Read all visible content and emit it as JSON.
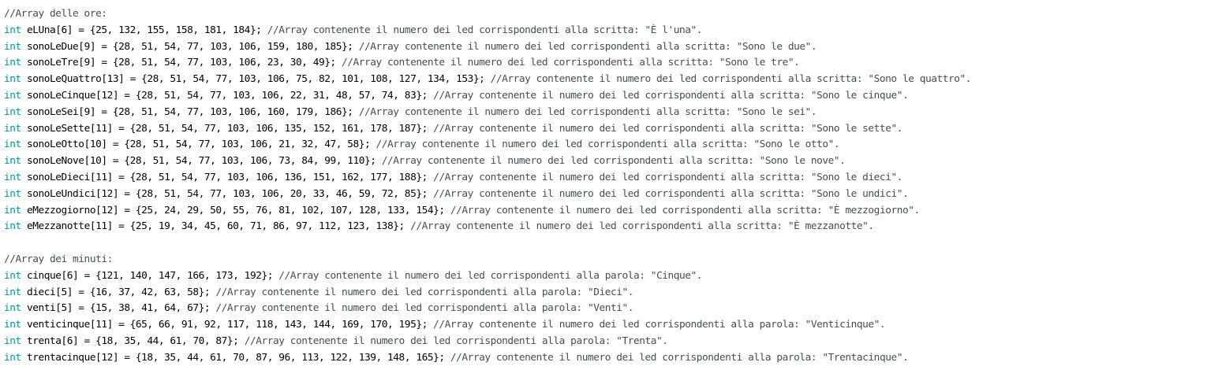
{
  "editor": {
    "lines": [
      {
        "type": "comment",
        "text": "//Array delle ore:"
      },
      {
        "type": "code",
        "kw": "int",
        "code": " eLUna[6] = {25, 132, 155, 158, 181, 184}; ",
        "comment": "//Array contenente il numero dei led corrispondenti alla scritta: \"È l'una\"."
      },
      {
        "type": "code",
        "kw": "int",
        "code": " sonoLeDue[9] = {28, 51, 54, 77, 103, 106, 159, 180, 185}; ",
        "comment": "//Array contenente il numero dei led corrispondenti alla scritta: \"Sono le due\"."
      },
      {
        "type": "code",
        "kw": "int",
        "code": " sonoLeTre[9] = {28, 51, 54, 77, 103, 106, 23, 30, 49}; ",
        "comment": "//Array contenente il numero dei led corrispondenti alla scritta: \"Sono le tre\"."
      },
      {
        "type": "code",
        "kw": "int",
        "code": " sonoLeQuattro[13] = {28, 51, 54, 77, 103, 106, 75, 82, 101, 108, 127, 134, 153}; ",
        "comment": "//Array contenente il numero dei led corrispondenti alla scritta: \"Sono le quattro\"."
      },
      {
        "type": "code",
        "kw": "int",
        "code": " sonoLeCinque[12] = {28, 51, 54, 77, 103, 106, 22, 31, 48, 57, 74, 83}; ",
        "comment": "//Array contenente il numero dei led corrispondenti alla scritta: \"Sono le cinque\"."
      },
      {
        "type": "code",
        "kw": "int",
        "code": " sonoLeSei[9] = {28, 51, 54, 77, 103, 106, 160, 179, 186}; ",
        "comment": "//Array contenente il numero dei led corrispondenti alla scritta: \"Sono le sei\"."
      },
      {
        "type": "code",
        "kw": "int",
        "code": " sonoLeSette[11] = {28, 51, 54, 77, 103, 106, 135, 152, 161, 178, 187}; ",
        "comment": "//Array contenente il numero dei led corrispondenti alla scritta: \"Sono le sette\"."
      },
      {
        "type": "code",
        "kw": "int",
        "code": " sonoLeOtto[10] = {28, 51, 54, 77, 103, 106, 21, 32, 47, 58}; ",
        "comment": "//Array contenente il numero dei led corrispondenti alla scritta: \"Sono le otto\"."
      },
      {
        "type": "code",
        "kw": "int",
        "code": " sonoLeNove[10] = {28, 51, 54, 77, 103, 106, 73, 84, 99, 110}; ",
        "comment": "//Array contenente il numero dei led corrispondenti alla scritta: \"Sono le nove\"."
      },
      {
        "type": "code",
        "kw": "int",
        "code": " sonoLeDieci[11] = {28, 51, 54, 77, 103, 106, 136, 151, 162, 177, 188}; ",
        "comment": "//Array contenente il numero dei led corrispondenti alla scritta: \"Sono le dieci\"."
      },
      {
        "type": "code",
        "kw": "int",
        "code": " sonoLeUndici[12] = {28, 51, 54, 77, 103, 106, 20, 33, 46, 59, 72, 85}; ",
        "comment": "//Array contenente il numero dei led corrispondenti alla scritta: \"Sono le undici\"."
      },
      {
        "type": "code",
        "kw": "int",
        "code": " eMezzogiorno[12] = {25, 24, 29, 50, 55, 76, 81, 102, 107, 128, 133, 154}; ",
        "comment": "//Array contenente il numero dei led corrispondenti alla scritta: \"È mezzogiorno\"."
      },
      {
        "type": "code",
        "kw": "int",
        "code": " eMezzanotte[11] = {25, 19, 34, 45, 60, 71, 86, 97, 112, 123, 138}; ",
        "comment": "//Array contenente il numero dei led corrispondenti alla scritta: \"È mezzanotte\"."
      },
      {
        "type": "blank",
        "text": ""
      },
      {
        "type": "comment",
        "text": "//Array dei minuti:"
      },
      {
        "type": "code",
        "kw": "int",
        "code": " cinque[6] = {121, 140, 147, 166, 173, 192}; ",
        "comment": "//Array contenente il numero dei led corrispondenti alla parola: \"Cinque\"."
      },
      {
        "type": "code",
        "kw": "int",
        "code": " dieci[5] = {16, 37, 42, 63, 58}; ",
        "comment": "//Array contenente il numero dei led corrispondenti alla parola: \"Dieci\"."
      },
      {
        "type": "code",
        "kw": "int",
        "code": " venti[5] = {15, 38, 41, 64, 67}; ",
        "comment": "//Array contenente il numero dei led corrispondenti alla parola: \"Venti\"."
      },
      {
        "type": "code",
        "kw": "int",
        "code": " venticinque[11] = {65, 66, 91, 92, 117, 118, 143, 144, 169, 170, 195}; ",
        "comment": "//Array contenente il numero dei led corrispondenti alla parola: \"Venticinque\"."
      },
      {
        "type": "code",
        "kw": "int",
        "code": " trenta[6] = {18, 35, 44, 61, 70, 87}; ",
        "comment": "//Array contenente il numero dei led corrispondenti alla parola: \"Trenta\"."
      },
      {
        "type": "code",
        "kw": "int",
        "code": " trentacinque[12] = {18, 35, 44, 61, 70, 87, 96, 113, 122, 139, 148, 165}; ",
        "comment": "//Array contenente il numero dei led corrispondenti alla parola: \"Trentacinque\"."
      }
    ],
    "colors": {
      "background": "#ffffff",
      "keyword": "#00979c",
      "comment": "#434f54",
      "text": "#000000"
    }
  }
}
